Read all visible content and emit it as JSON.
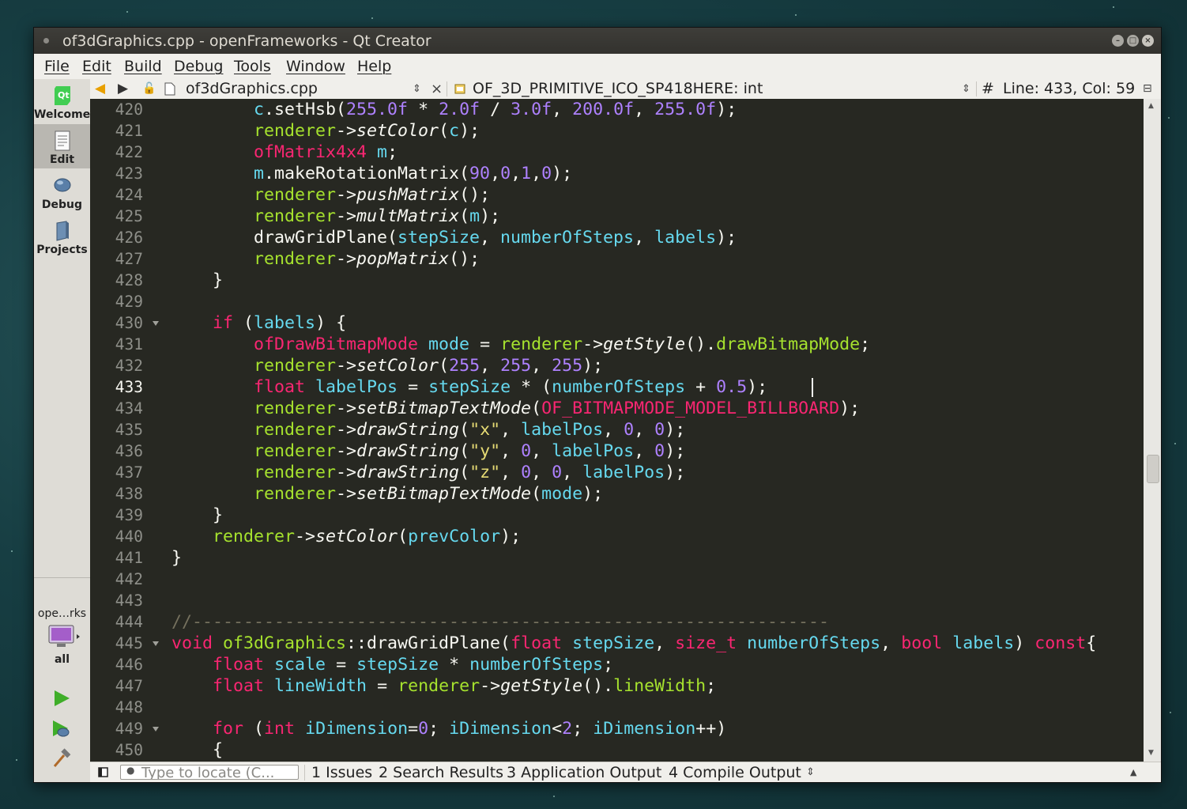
{
  "window": {
    "title": "of3dGraphics.cpp - openFrameworks - Qt Creator"
  },
  "menu": [
    "File",
    "Edit",
    "Build",
    "Debug",
    "Tools",
    "Window",
    "Help"
  ],
  "modes": [
    {
      "label": "Welcome",
      "icon": "qt-logo-icon"
    },
    {
      "label": "Edit",
      "icon": "document-icon",
      "active": true
    },
    {
      "label": "Debug",
      "icon": "bug-icon"
    },
    {
      "label": "Projects",
      "icon": "folder-icon"
    }
  ],
  "target": {
    "project": "ope…rks",
    "kit": "all"
  },
  "editor_toolbar": {
    "file": "of3dGraphics.cpp",
    "symbol": "OF_3D_PRIMITIVE_ICO_SP418HERE: int",
    "hash": "#",
    "position": "Line: 433, Col: 59"
  },
  "editor": {
    "first_line": 420,
    "current_line": 433,
    "line_numbers": [
      "420",
      "421",
      "422",
      "423",
      "424",
      "425",
      "426",
      "427",
      "428",
      "429",
      "430",
      "431",
      "432",
      "433",
      "434",
      "435",
      "436",
      "437",
      "438",
      "439",
      "440",
      "441",
      "442",
      "443",
      "444",
      "445",
      "446",
      "447",
      "448",
      "449",
      "450"
    ],
    "fold_lines": [
      430,
      445,
      449
    ]
  },
  "statusbar": {
    "locator_placeholder": "Type to locate (C...",
    "panes": [
      "1 Issues",
      "2 Search Results",
      "3 Application Output",
      "4 Compile Output"
    ]
  },
  "colors": {
    "editor_bg": "#272822",
    "keyword": "#f92672",
    "number": "#ae81ff",
    "string": "#e6db74",
    "member": "#a6e22e",
    "variable": "#66d9ef",
    "comment": "#75715e"
  }
}
